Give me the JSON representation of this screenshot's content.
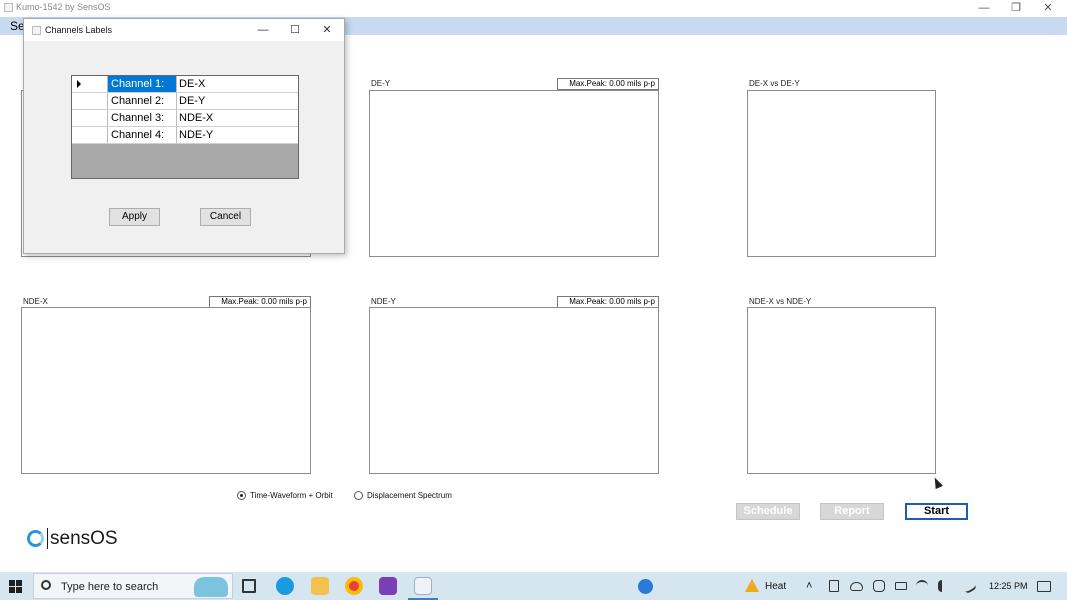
{
  "window": {
    "title": "Kumo-1542 by SensOS",
    "minimize": "—",
    "restore": "❐",
    "close": "✕"
  },
  "menubar": {
    "first_item": "Se"
  },
  "panels": {
    "de_x": {
      "label": ""
    },
    "de_y": {
      "label": "DE-Y",
      "peak": "Max.Peak: 0.00 mils p-p"
    },
    "de_x_vs_de_y": {
      "label": "DE-X vs DE-Y"
    },
    "nde_x": {
      "label": "NDE-X",
      "peak": "Max.Peak: 0.00 mils p-p"
    },
    "nde_y": {
      "label": "NDE-Y",
      "peak": "Max.Peak: 0.00 mils p-p"
    },
    "nde_x_vs_nde_y": {
      "label": "NDE-X vs NDE-Y"
    }
  },
  "dialog": {
    "title": "Channels Labels",
    "minimize": "—",
    "maximize": "☐",
    "close": "✕",
    "rows": [
      {
        "channel": "Channel 1:",
        "label": "DE-X"
      },
      {
        "channel": "Channel 2:",
        "label": "DE-Y"
      },
      {
        "channel": "Channel 3:",
        "label": "NDE-X"
      },
      {
        "channel": "Channel 4:",
        "label": "NDE-Y"
      }
    ],
    "apply": "Apply",
    "cancel": "Cancel"
  },
  "view_mode": {
    "option1": "Time-Waveform + Orbit",
    "option2": "Displacement Spectrum",
    "selected": "Time-Waveform + Orbit"
  },
  "actions": {
    "schedule": "Schedule",
    "report": "Report",
    "start": "Start"
  },
  "logo": {
    "text": "sensOS"
  },
  "taskbar": {
    "search_placeholder": "Type here to search",
    "weather": "Heat",
    "time": "12:25 PM"
  }
}
